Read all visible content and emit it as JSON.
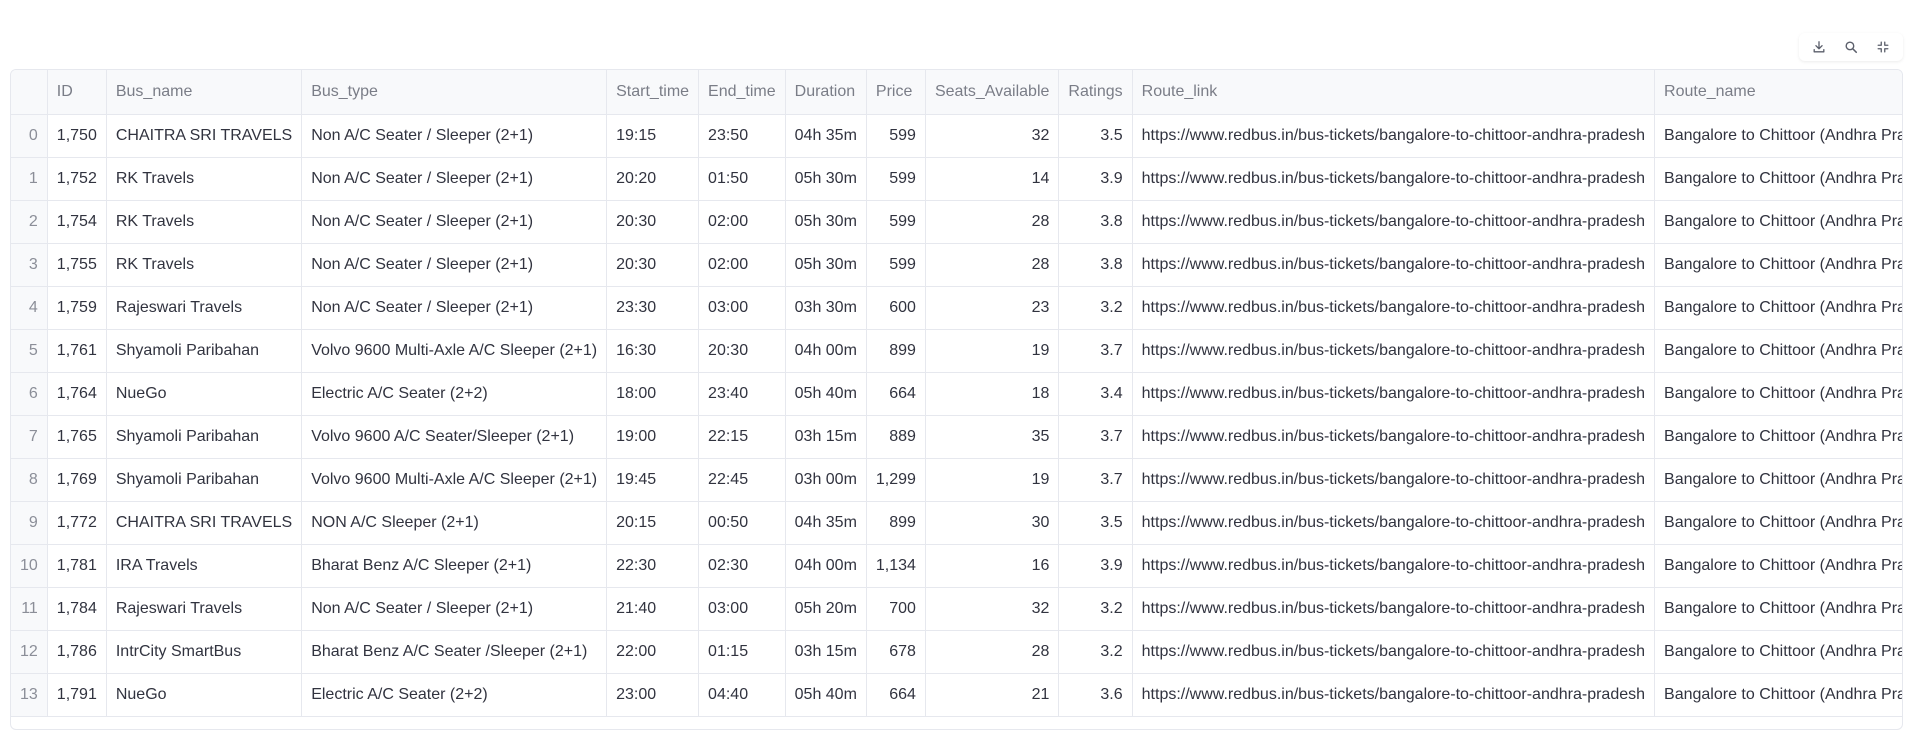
{
  "toolbar": {
    "download_icon": "download-icon",
    "search_icon": "search-icon",
    "fullscreen_icon": "fullscreen-icon"
  },
  "table": {
    "columns": [
      "",
      "ID",
      "Bus_name",
      "Bus_type",
      "Start_time",
      "End_time",
      "Duration",
      "Price",
      "Seats_Available",
      "Ratings",
      "Route_link",
      "Route_name"
    ],
    "rows": [
      [
        "0",
        "1,750",
        "CHAITRA SRI TRAVELS",
        "Non A/C Seater / Sleeper (2+1)",
        "19:15",
        "23:50",
        "04h 35m",
        "599",
        "32",
        "3.5",
        "https://www.redbus.in/bus-tickets/bangalore-to-chittoor-andhra-pradesh",
        "Bangalore to Chittoor (Andhra Pradesh)"
      ],
      [
        "1",
        "1,752",
        "RK Travels",
        "Non A/C Seater / Sleeper (2+1)",
        "20:20",
        "01:50",
        "05h 30m",
        "599",
        "14",
        "3.9",
        "https://www.redbus.in/bus-tickets/bangalore-to-chittoor-andhra-pradesh",
        "Bangalore to Chittoor (Andhra Pradesh)"
      ],
      [
        "2",
        "1,754",
        "RK Travels",
        "Non A/C Seater / Sleeper (2+1)",
        "20:30",
        "02:00",
        "05h 30m",
        "599",
        "28",
        "3.8",
        "https://www.redbus.in/bus-tickets/bangalore-to-chittoor-andhra-pradesh",
        "Bangalore to Chittoor (Andhra Pradesh)"
      ],
      [
        "3",
        "1,755",
        "RK Travels",
        "Non A/C Seater / Sleeper (2+1)",
        "20:30",
        "02:00",
        "05h 30m",
        "599",
        "28",
        "3.8",
        "https://www.redbus.in/bus-tickets/bangalore-to-chittoor-andhra-pradesh",
        "Bangalore to Chittoor (Andhra Pradesh)"
      ],
      [
        "4",
        "1,759",
        "Rajeswari Travels",
        "Non A/C Seater / Sleeper (2+1)",
        "23:30",
        "03:00",
        "03h 30m",
        "600",
        "23",
        "3.2",
        "https://www.redbus.in/bus-tickets/bangalore-to-chittoor-andhra-pradesh",
        "Bangalore to Chittoor (Andhra Pradesh)"
      ],
      [
        "5",
        "1,761",
        "Shyamoli Paribahan",
        "Volvo 9600 Multi-Axle A/C Sleeper (2+1)",
        "16:30",
        "20:30",
        "04h 00m",
        "899",
        "19",
        "3.7",
        "https://www.redbus.in/bus-tickets/bangalore-to-chittoor-andhra-pradesh",
        "Bangalore to Chittoor (Andhra Pradesh)"
      ],
      [
        "6",
        "1,764",
        "NueGo",
        "Electric A/C Seater (2+2)",
        "18:00",
        "23:40",
        "05h 40m",
        "664",
        "18",
        "3.4",
        "https://www.redbus.in/bus-tickets/bangalore-to-chittoor-andhra-pradesh",
        "Bangalore to Chittoor (Andhra Pradesh)"
      ],
      [
        "7",
        "1,765",
        "Shyamoli Paribahan",
        "Volvo 9600 A/C Seater/Sleeper (2+1)",
        "19:00",
        "22:15",
        "03h 15m",
        "889",
        "35",
        "3.7",
        "https://www.redbus.in/bus-tickets/bangalore-to-chittoor-andhra-pradesh",
        "Bangalore to Chittoor (Andhra Pradesh)"
      ],
      [
        "8",
        "1,769",
        "Shyamoli Paribahan",
        "Volvo 9600 Multi-Axle A/C Sleeper (2+1)",
        "19:45",
        "22:45",
        "03h 00m",
        "1,299",
        "19",
        "3.7",
        "https://www.redbus.in/bus-tickets/bangalore-to-chittoor-andhra-pradesh",
        "Bangalore to Chittoor (Andhra Pradesh)"
      ],
      [
        "9",
        "1,772",
        "CHAITRA SRI TRAVELS",
        "NON A/C Sleeper (2+1)",
        "20:15",
        "00:50",
        "04h 35m",
        "899",
        "30",
        "3.5",
        "https://www.redbus.in/bus-tickets/bangalore-to-chittoor-andhra-pradesh",
        "Bangalore to Chittoor (Andhra Pradesh)"
      ],
      [
        "10",
        "1,781",
        "IRA Travels",
        "Bharat Benz A/C Sleeper (2+1)",
        "22:30",
        "02:30",
        "04h 00m",
        "1,134",
        "16",
        "3.9",
        "https://www.redbus.in/bus-tickets/bangalore-to-chittoor-andhra-pradesh",
        "Bangalore to Chittoor (Andhra Pradesh)"
      ],
      [
        "11",
        "1,784",
        "Rajeswari Travels",
        "Non A/C Seater / Sleeper (2+1)",
        "21:40",
        "03:00",
        "05h 20m",
        "700",
        "32",
        "3.2",
        "https://www.redbus.in/bus-tickets/bangalore-to-chittoor-andhra-pradesh",
        "Bangalore to Chittoor (Andhra Pradesh)"
      ],
      [
        "12",
        "1,786",
        "IntrCity SmartBus",
        "Bharat Benz A/C Seater /Sleeper (2+1)",
        "22:00",
        "01:15",
        "03h 15m",
        "678",
        "28",
        "3.2",
        "https://www.redbus.in/bus-tickets/bangalore-to-chittoor-andhra-pradesh",
        "Bangalore to Chittoor (Andhra Pradesh)"
      ],
      [
        "13",
        "1,791",
        "NueGo",
        "Electric A/C Seater (2+2)",
        "23:00",
        "04:40",
        "05h 40m",
        "664",
        "21",
        "3.6",
        "https://www.redbus.in/bus-tickets/bangalore-to-chittoor-andhra-pradesh",
        "Bangalore to Chittoor (Andhra Pradesh)"
      ]
    ]
  }
}
